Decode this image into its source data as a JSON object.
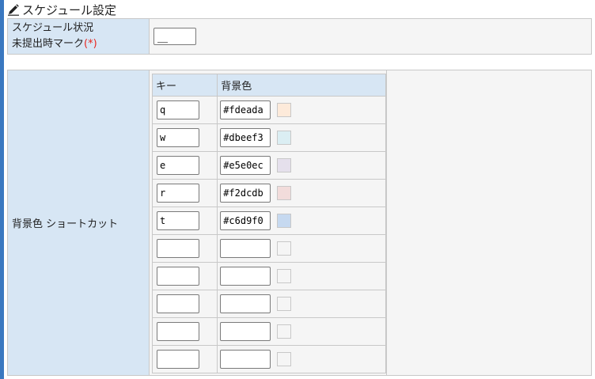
{
  "header": {
    "title": "スケジュール設定"
  },
  "schedule_status": {
    "label_line1": "スケジュール状況",
    "label_line2": "未提出時マーク",
    "required": "(*)",
    "mark_value": "＿"
  },
  "shortcut": {
    "label": "背景色 ショートカット",
    "col_key": "キー",
    "col_color": "背景色",
    "rows": [
      {
        "key": "q",
        "color": "#fdeada"
      },
      {
        "key": "w",
        "color": "#dbeef3"
      },
      {
        "key": "e",
        "color": "#e5e0ec"
      },
      {
        "key": "r",
        "color": "#f2dcdb"
      },
      {
        "key": "t",
        "color": "#c6d9f0"
      },
      {
        "key": "",
        "color": ""
      },
      {
        "key": "",
        "color": ""
      },
      {
        "key": "",
        "color": ""
      },
      {
        "key": "",
        "color": ""
      },
      {
        "key": "",
        "color": ""
      }
    ]
  },
  "colors": {
    "label_bg": "#d7e6f4",
    "accent": "#3a78c0",
    "required": "#e8261e"
  }
}
